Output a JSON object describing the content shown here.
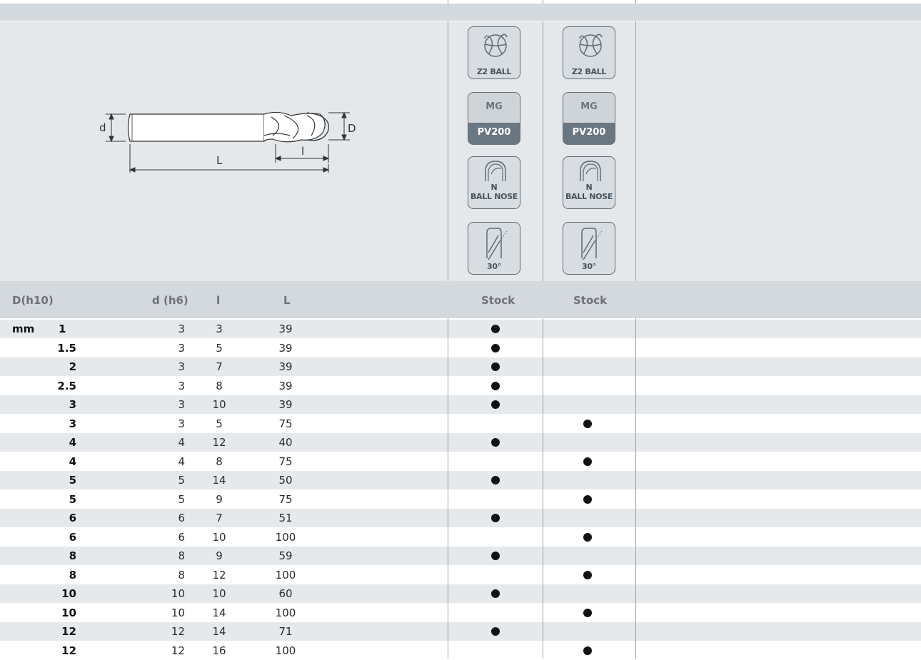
{
  "header": {
    "col_D": "D(h10)",
    "col_d": "d (h6)",
    "col_l": "l",
    "col_L": "L",
    "col_stock_1": "Stock",
    "col_stock_2": "Stock"
  },
  "diagram": {
    "label_d": "d",
    "label_D": "D",
    "label_l": "l",
    "label_L": "L"
  },
  "columns": [
    {
      "type_label": "Z2 BALL",
      "material_top": "MG",
      "material_bottom": "PV200",
      "shape_label_1": "N",
      "shape_label_2": "BALL NOSE",
      "helix_label": "30°"
    },
    {
      "type_label": "Z2 BALL",
      "material_top": "MG",
      "material_bottom": "PV200",
      "shape_label_1": "N",
      "shape_label_2": "BALL NOSE",
      "helix_label": "30°"
    }
  ],
  "unit": "mm",
  "rows": [
    {
      "D": "1",
      "d": "3",
      "l": "3",
      "L": "39",
      "stock1": true,
      "stock2": false
    },
    {
      "D": "1.5",
      "d": "3",
      "l": "5",
      "L": "39",
      "stock1": true,
      "stock2": false
    },
    {
      "D": "2",
      "d": "3",
      "l": "7",
      "L": "39",
      "stock1": true,
      "stock2": false
    },
    {
      "D": "2.5",
      "d": "3",
      "l": "8",
      "L": "39",
      "stock1": true,
      "stock2": false
    },
    {
      "D": "3",
      "d": "3",
      "l": "10",
      "L": "39",
      "stock1": true,
      "stock2": false
    },
    {
      "D": "3",
      "d": "3",
      "l": "5",
      "L": "75",
      "stock1": false,
      "stock2": true
    },
    {
      "D": "4",
      "d": "4",
      "l": "12",
      "L": "40",
      "stock1": true,
      "stock2": false
    },
    {
      "D": "4",
      "d": "4",
      "l": "8",
      "L": "75",
      "stock1": false,
      "stock2": true
    },
    {
      "D": "5",
      "d": "5",
      "l": "14",
      "L": "50",
      "stock1": true,
      "stock2": false
    },
    {
      "D": "5",
      "d": "5",
      "l": "9",
      "L": "75",
      "stock1": false,
      "stock2": true
    },
    {
      "D": "6",
      "d": "6",
      "l": "7",
      "L": "51",
      "stock1": true,
      "stock2": false
    },
    {
      "D": "6",
      "d": "6",
      "l": "10",
      "L": "100",
      "stock1": false,
      "stock2": true
    },
    {
      "D": "8",
      "d": "8",
      "l": "9",
      "L": "59",
      "stock1": true,
      "stock2": false
    },
    {
      "D": "8",
      "d": "8",
      "l": "12",
      "L": "100",
      "stock1": false,
      "stock2": true
    },
    {
      "D": "10",
      "d": "10",
      "l": "10",
      "L": "60",
      "stock1": true,
      "stock2": false
    },
    {
      "D": "10",
      "d": "10",
      "l": "14",
      "L": "100",
      "stock1": false,
      "stock2": true
    },
    {
      "D": "12",
      "d": "12",
      "l": "14",
      "L": "71",
      "stock1": true,
      "stock2": false
    },
    {
      "D": "12",
      "d": "12",
      "l": "16",
      "L": "100",
      "stock1": false,
      "stock2": true
    }
  ]
}
